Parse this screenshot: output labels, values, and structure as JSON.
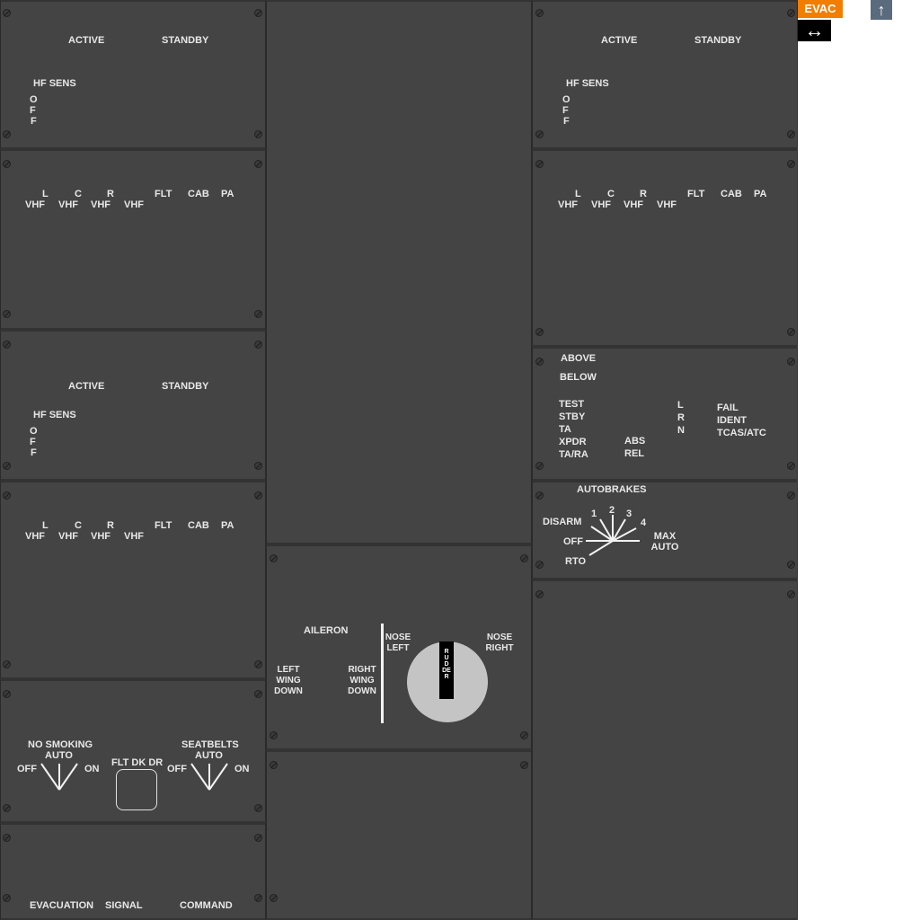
{
  "radio_panel": {
    "active": "ACTIVE",
    "standby": "STANDBY",
    "hf_sens": "HF SENS",
    "off_letters": [
      "O",
      "F",
      "F"
    ]
  },
  "audio_panel": {
    "top": [
      "L",
      "C",
      "R",
      "FLT",
      "CAB",
      "PA"
    ],
    "bottom": [
      "VHF",
      "VHF",
      "VHF",
      "VHF"
    ]
  },
  "transponder": {
    "above": "ABOVE",
    "below": "BELOW",
    "modes": [
      "TEST",
      "STBY",
      "TA",
      "XPDR",
      "TA/RA"
    ],
    "abs": "ABS",
    "rel": "REL",
    "lrn": [
      "L",
      "R",
      "N"
    ],
    "fail": "FAIL",
    "ident": "IDENT",
    "tcas": "TCAS/ATC"
  },
  "autobrakes": {
    "title": "AUTOBRAKES",
    "disarm": "DISARM",
    "off": "OFF",
    "rto": "RTO",
    "positions": [
      "1",
      "2",
      "3",
      "4"
    ],
    "max_auto": "MAX AUTO"
  },
  "trim": {
    "aileron": "AILERON",
    "left_wing_down": "LEFT WING DOWN",
    "right_wing_down": "RIGHT WING DOWN",
    "nose_left": "NOSE LEFT",
    "nose_right": "NOSE RIGHT",
    "rudder": "RUDDER"
  },
  "signs": {
    "no_smoking": "NO SMOKING",
    "auto": "AUTO",
    "off": "OFF",
    "on": "ON",
    "flt_dk_dr": "FLT DK DR",
    "seatbelts": "SEATBELTS"
  },
  "evacuation": {
    "evacuation": "EVACUATION",
    "signal": "SIGNAL",
    "command": "COMMAND"
  },
  "toolbar": {
    "evac": "EVAC",
    "swap_icon": "↔",
    "up_icon": "↑"
  },
  "colors": {
    "panel": "#444444",
    "evac_orange": "#f27d00",
    "up_button": "#5a6b7e"
  }
}
